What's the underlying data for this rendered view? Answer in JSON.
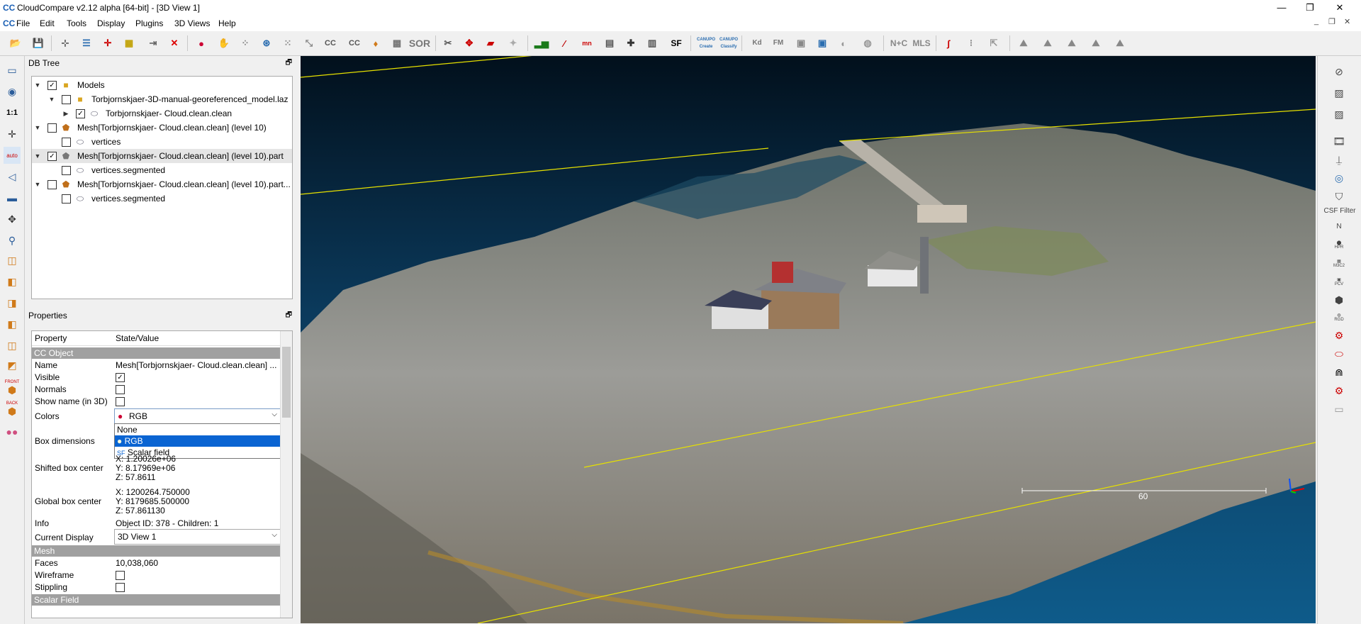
{
  "window": {
    "title": "CloudCompare v2.12 alpha [64-bit] - [3D View 1]",
    "controls": [
      "—",
      "❐",
      "✕"
    ],
    "mdi_controls": [
      "_",
      "❐",
      "✕"
    ]
  },
  "menu": [
    "File",
    "Edit",
    "Tools",
    "Display",
    "Plugins",
    "3D Views",
    "Help"
  ],
  "toolbar": {
    "text_buttons": [
      "CC",
      "SOR",
      "SF",
      "Kd",
      "FM",
      "N+C",
      "MLS"
    ],
    "canupo_create": "CANUPO\nCreate",
    "canupo_classify": "CANUPO\nClassify"
  },
  "left_toolbar": {
    "zoom_label": "1:1",
    "auto_label": "auto",
    "front_label": "FRONT",
    "back_label": "BACK"
  },
  "db_tree": {
    "title": "DB Tree",
    "items": [
      {
        "label": "Models",
        "checked": true
      },
      {
        "label": "Torbjornskjaer-3D-manual-georeferenced_model.laz",
        "checked": false
      },
      {
        "label": "Torbjornskjaer- Cloud.clean.clean",
        "checked": true
      },
      {
        "label": "Mesh[Torbjornskjaer- Cloud.clean.clean] (level 10)",
        "checked": false
      },
      {
        "label": "vertices",
        "checked": false
      },
      {
        "label": "Mesh[Torbjornskjaer- Cloud.clean.clean] (level 10).part",
        "checked": true
      },
      {
        "label": "vertices.segmented",
        "checked": false
      },
      {
        "label": "Mesh[Torbjornskjaer- Cloud.clean.clean] (level 10).part...",
        "checked": false
      },
      {
        "label": "vertices.segmented",
        "checked": false
      }
    ]
  },
  "properties": {
    "title": "Properties",
    "col_property": "Property",
    "col_value": "State/Value",
    "section_cc_object": "CC Object",
    "name_label": "Name",
    "name_value": "Mesh[Torbjornskjaer- Cloud.clean.clean] ...",
    "visible_label": "Visible",
    "normals_label": "Normals",
    "show_name_label": "Show name (in 3D)",
    "colors_label": "Colors",
    "colors_value": "RGB",
    "colors_options": [
      "None",
      "RGB",
      "Scalar field"
    ],
    "box_dimensions_label": "Box dimensions",
    "shifted_center_label": "Shifted box center",
    "shifted_center": [
      "X: 1.20026e+06",
      "Y: 8.17969e+06",
      "Z: 57.8611"
    ],
    "global_center_label": "Global box center",
    "global_center": [
      "X: 1200264.750000",
      "Y: 8179685.500000",
      "Z: 57.861130"
    ],
    "info_label": "Info",
    "info_value": "Object ID: 378 - Children: 1",
    "current_display_label": "Current Display",
    "current_display_value": "3D View 1",
    "section_mesh": "Mesh",
    "faces_label": "Faces",
    "faces_value": "10,038,060",
    "wireframe_label": "Wireframe",
    "stippling_label": "Stippling",
    "section_scalar_field": "Scalar Field"
  },
  "viewport": {
    "scale_label": "60",
    "sea_color": "#0b3a5c",
    "rock_color": "#8c8c8c"
  },
  "right_toolbar": {
    "csf_label": "CSF Filter",
    "n_label": "N",
    "hpr_label": "HPR",
    "m3c2_label": "M3C2",
    "pcv_label": "PCV",
    "rgd_label": "RGD"
  }
}
